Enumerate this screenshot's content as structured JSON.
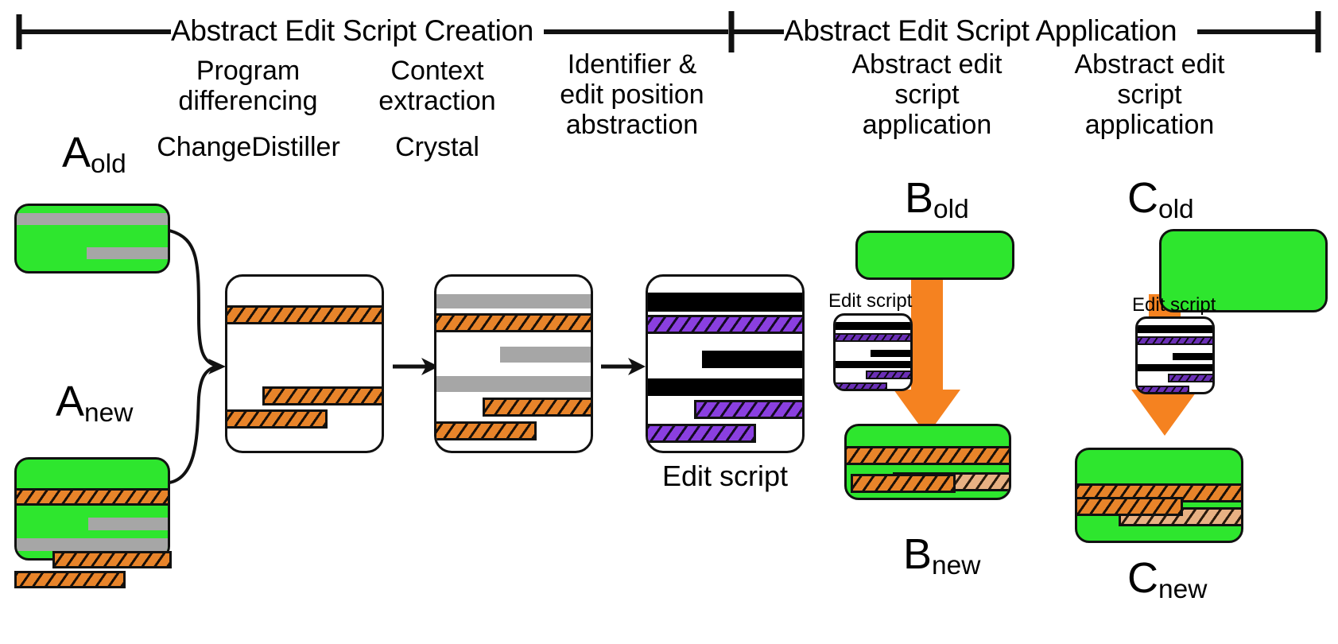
{
  "phases": [
    {
      "label": "Abstract Edit Script Creation"
    },
    {
      "label": "Abstract Edit Script Application"
    }
  ],
  "steps": [
    {
      "title": "Program\ndifferencing",
      "tool": "ChangeDistiller"
    },
    {
      "title": "Context\nextraction",
      "tool": "Crystal"
    },
    {
      "title": "Identifier &\nedit position\nabstraction",
      "tool": ""
    },
    {
      "title": "Abstract edit\nscript\napplication",
      "tool": ""
    },
    {
      "title": "Abstract edit\nscript\napplication",
      "tool": ""
    }
  ],
  "nodes": {
    "a_old": {
      "base": "A",
      "sub": "old"
    },
    "a_new": {
      "base": "A",
      "sub": "new"
    },
    "b_old": {
      "base": "B",
      "sub": "old"
    },
    "b_new": {
      "base": "B",
      "sub": "new"
    },
    "c_old": {
      "base": "C",
      "sub": "old"
    },
    "c_new": {
      "base": "C",
      "sub": "new"
    }
  },
  "captions": {
    "edit_script_main": "Edit script",
    "edit_script_b": "Edit script",
    "edit_script_c": "Edit script"
  },
  "colors": {
    "green": "#2ee62e",
    "orange": "#e8842a",
    "orange_light": "#e8b183",
    "purple": "#8a3fe0",
    "gray": "#a6a6a6",
    "black": "#000000",
    "arrow_orange": "#f58220",
    "outline": "#111111"
  }
}
